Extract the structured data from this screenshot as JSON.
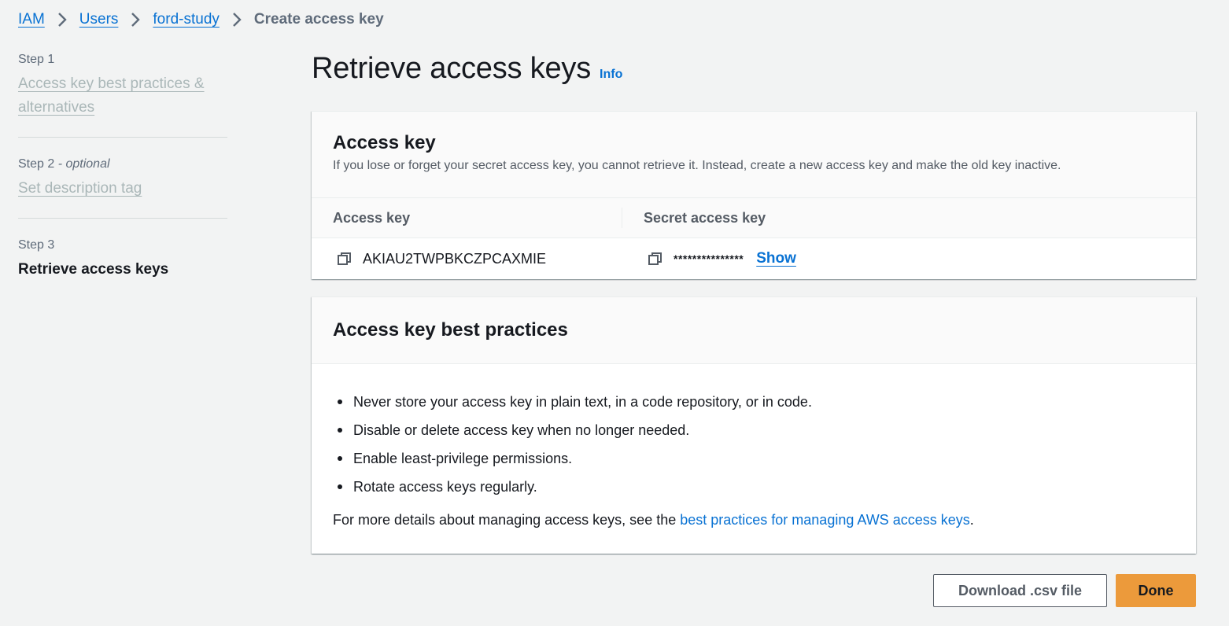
{
  "breadcrumb": {
    "items": [
      "IAM",
      "Users",
      "ford-study"
    ],
    "current": "Create access key"
  },
  "steps": [
    {
      "label": "Step 1",
      "title": "Access key best practices & alternatives"
    },
    {
      "label": "Step 2",
      "label_suffix": " - optional",
      "title": "Set description tag"
    },
    {
      "label": "Step 3",
      "title": "Retrieve access keys"
    }
  ],
  "page": {
    "title": "Retrieve access keys",
    "info": "Info"
  },
  "access_key_panel": {
    "title": "Access key",
    "description": "If you lose or forget your secret access key, you cannot retrieve it. Instead, create a new access key and make the old key inactive.",
    "columns": [
      "Access key",
      "Secret access key"
    ],
    "access_key_value": "AKIAU2TWPBKCZPCAXMIE",
    "secret_masked": "***************",
    "show_label": "Show"
  },
  "best_practices_panel": {
    "title": "Access key best practices",
    "items": [
      "Never store your access key in plain text, in a code repository, or in code.",
      "Disable or delete access key when no longer needed.",
      "Enable least-privilege permissions.",
      "Rotate access keys regularly."
    ],
    "footer_prefix": "For more details about managing access keys, see the ",
    "footer_link": "best practices for managing AWS access keys",
    "footer_suffix": "."
  },
  "buttons": {
    "download": "Download .csv file",
    "done": "Done"
  },
  "colors": {
    "link": "#0972d3",
    "primary_button": "#ec9a3b",
    "background": "#f2f3f3"
  },
  "icons": {
    "breadcrumb_separator": "chevron-right-icon",
    "copy": "copy-icon"
  }
}
